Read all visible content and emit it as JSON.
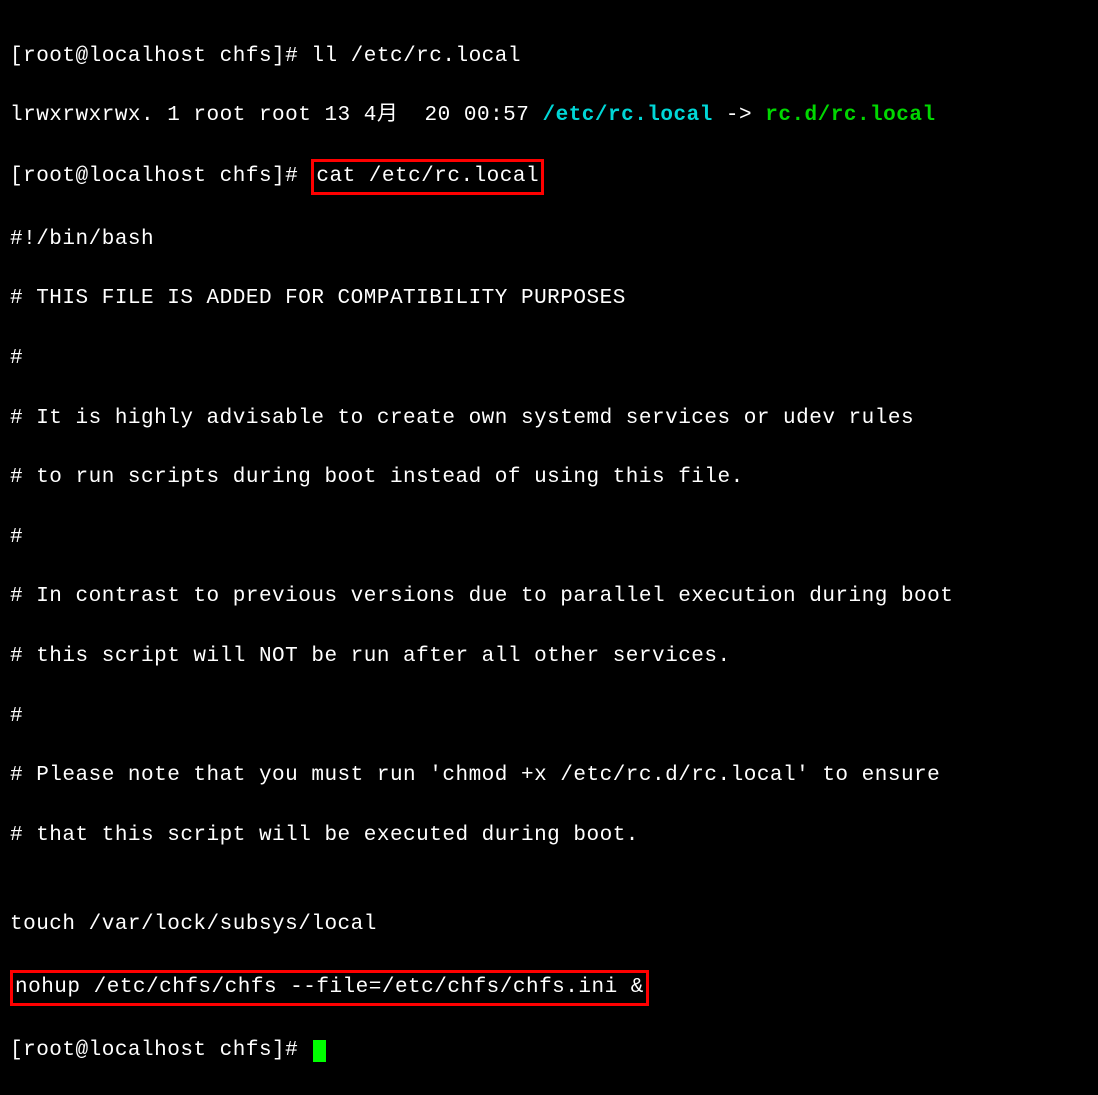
{
  "terminal": {
    "line1_prompt": "[root@localhost chfs]# ",
    "line1_cmd": "ll /etc/rc.local",
    "line2_perms": "lrwxrwxrwx. 1 root root 13 4月  20 00:57 ",
    "line2_link": "/etc/rc.local",
    "line2_arrow": " -> ",
    "line2_target": "rc.d/rc.local",
    "line3_prompt": "[root@localhost chfs]# ",
    "line3_cmd": "cat /etc/rc.local",
    "file_line1": "#!/bin/bash",
    "file_line2": "# THIS FILE IS ADDED FOR COMPATIBILITY PURPOSES",
    "file_line3": "#",
    "file_line4": "# It is highly advisable to create own systemd services or udev rules",
    "file_line5": "# to run scripts during boot instead of using this file.",
    "file_line6": "#",
    "file_line7": "# In contrast to previous versions due to parallel execution during boot",
    "file_line8": "# this script will NOT be run after all other services.",
    "file_line9": "#",
    "file_line10": "# Please note that you must run 'chmod +x /etc/rc.d/rc.local' to ensure",
    "file_line11": "# that this script will be executed during boot.",
    "file_line12": "",
    "file_line13": "touch /var/lock/subsys/local",
    "file_line14": "nohup /etc/chfs/chfs --file=/etc/chfs/chfs.ini &",
    "final_prompt": "[root@localhost chfs]# "
  }
}
